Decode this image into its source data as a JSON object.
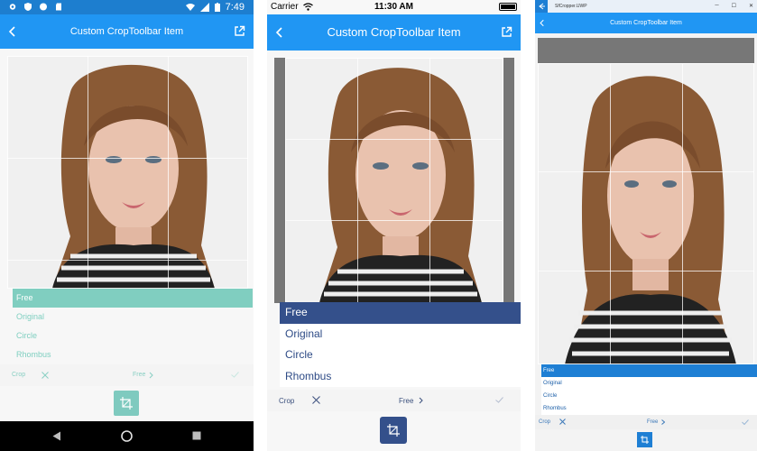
{
  "android": {
    "status": {
      "time": "7:49"
    },
    "appbar": {
      "title": "Custom CropToolbar Item"
    },
    "options": [
      "Free",
      "Original",
      "Circle",
      "Rhombus"
    ],
    "selected_option": "Free",
    "toolbar": {
      "crop_label": "Crop",
      "mode_label": "Free"
    },
    "accent": "#80cec0"
  },
  "ios": {
    "status": {
      "carrier": "Carrier",
      "time": "11:30 AM"
    },
    "appbar": {
      "title": "Custom CropToolbar Item"
    },
    "options": [
      "Free",
      "Original",
      "Circle",
      "Rhombus"
    ],
    "selected_option": "Free",
    "toolbar": {
      "crop_label": "Crop",
      "mode_label": "Free"
    },
    "accent": "#34508b"
  },
  "uwp": {
    "window": {
      "title": "SfCropper.UWP"
    },
    "appbar": {
      "title": "Custom CropToolbar Item"
    },
    "options": [
      "Free",
      "Original",
      "Circle",
      "Rhombus"
    ],
    "selected_option": "Free",
    "toolbar": {
      "crop_label": "Crop",
      "mode_label": "Free"
    },
    "accent": "#1e7fd4"
  }
}
